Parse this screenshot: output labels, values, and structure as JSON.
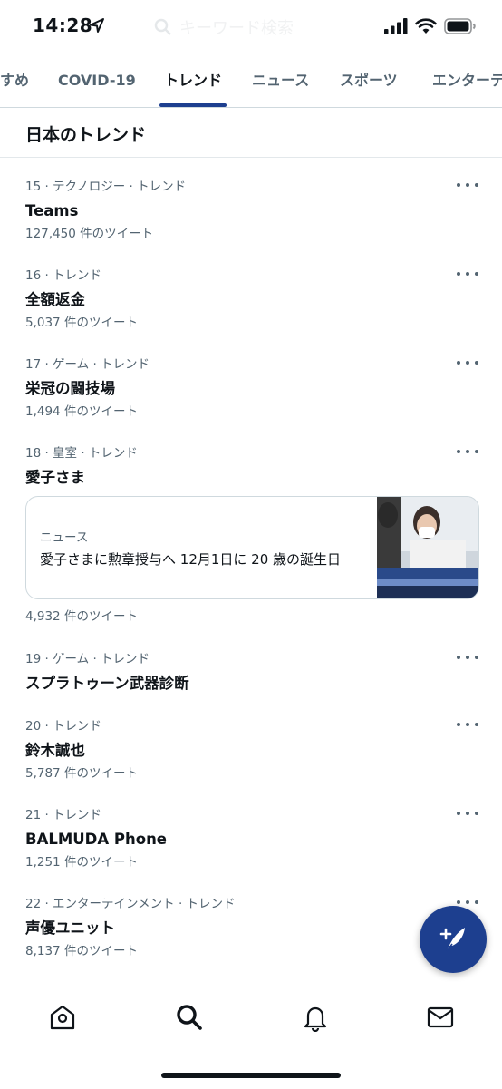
{
  "status_bar": {
    "time": "14:28"
  },
  "search": {
    "placeholder": "キーワード検索"
  },
  "tabs": [
    {
      "label": "すめ"
    },
    {
      "label": "COVID-19"
    },
    {
      "label": "トレンド",
      "active": true
    },
    {
      "label": "ニュース"
    },
    {
      "label": "スポーツ"
    },
    {
      "label": "エンターテ"
    }
  ],
  "section": {
    "title": "日本のトレンド"
  },
  "trends": [
    {
      "meta": "15 · テクノロジー · トレンド",
      "name": "Teams",
      "count": "127,450 件のツイート"
    },
    {
      "meta": "16 · トレンド",
      "name": "全額返金",
      "count": "5,037 件のツイート"
    },
    {
      "meta": "17 · ゲーム · トレンド",
      "name": "栄冠の闘技場",
      "count": "1,494 件のツイート"
    },
    {
      "meta": "18 · 皇室 · トレンド",
      "name": "愛子さま",
      "count": "4,932 件のツイート"
    },
    {
      "meta": "19 · ゲーム · トレンド",
      "name": "スプラトゥーン武器診断",
      "count": ""
    },
    {
      "meta": "20 · トレンド",
      "name": "鈴木誠也",
      "count": "5,787 件のツイート"
    },
    {
      "meta": "21 · トレンド",
      "name": "BALMUDA Phone",
      "count": "1,251 件のツイート"
    },
    {
      "meta": "22 · エンターテインメント · トレンド",
      "name": "声優ユニット",
      "count": "8,137 件のツイート"
    }
  ],
  "news_card": {
    "label": "ニュース",
    "headline": "愛子さまに勲章授与へ 12月1日に 20 歳の誕生日"
  },
  "colors": {
    "accent": "#1d3f8f",
    "text": "#0f1419",
    "secondary": "#536471"
  },
  "icons": [
    "location-arrow-icon",
    "signal-icon",
    "wifi-icon",
    "battery-icon",
    "more-icon",
    "compose-tweet-icon",
    "home-icon",
    "search-icon",
    "notifications-bell-icon",
    "messages-mail-icon"
  ]
}
